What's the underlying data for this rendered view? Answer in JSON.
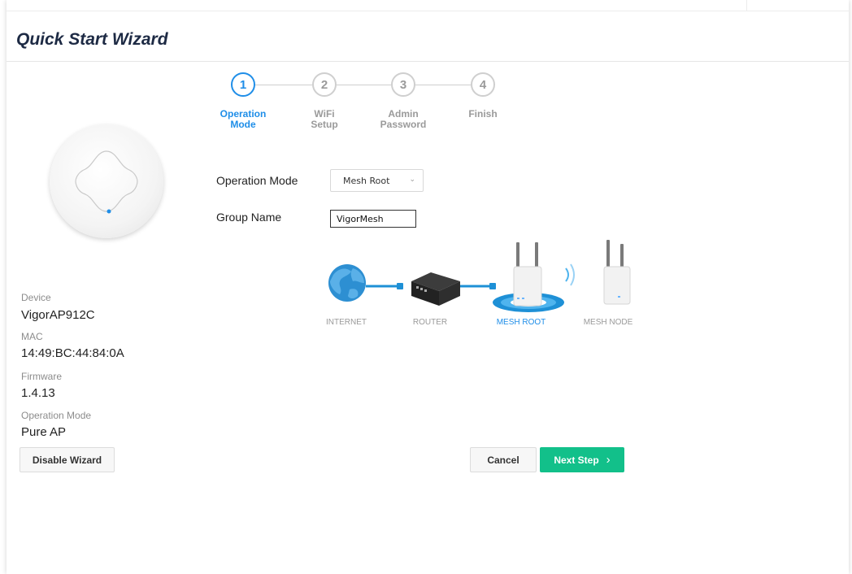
{
  "page": {
    "title": "Quick Start Wizard"
  },
  "steps": [
    {
      "number": "1",
      "label_line1": "Operation",
      "label_line2": "Mode",
      "active": true
    },
    {
      "number": "2",
      "label_line1": "WiFi",
      "label_line2": "Setup",
      "active": false
    },
    {
      "number": "3",
      "label_line1": "Admin",
      "label_line2": "Password",
      "active": false
    },
    {
      "number": "4",
      "label_line1": "Finish",
      "label_line2": "",
      "active": false
    }
  ],
  "device_info": {
    "device_label": "Device",
    "device_value": "VigorAP912C",
    "mac_label": "MAC",
    "mac_value": "14:49:BC:44:84:0A",
    "firmware_label": "Firmware",
    "firmware_value": "1.4.13",
    "mode_label": "Operation Mode",
    "mode_value": "Pure AP"
  },
  "form": {
    "operation_mode_label": "Operation Mode",
    "operation_mode_value": "Mesh Root",
    "group_name_label": "Group Name",
    "group_name_value": "VigorMesh"
  },
  "diagram": {
    "internet": "INTERNET",
    "router": "ROUTER",
    "mesh_root": "MESH ROOT",
    "mesh_node": "MESH NODE"
  },
  "buttons": {
    "disable_wizard": "Disable Wizard",
    "cancel": "Cancel",
    "next_step": "Next Step",
    "next_icon": "chevron-right-icon"
  },
  "colors": {
    "active_blue": "#1f8ee8",
    "primary_green": "#12c08a",
    "cable_blue": "#1e90d6"
  }
}
